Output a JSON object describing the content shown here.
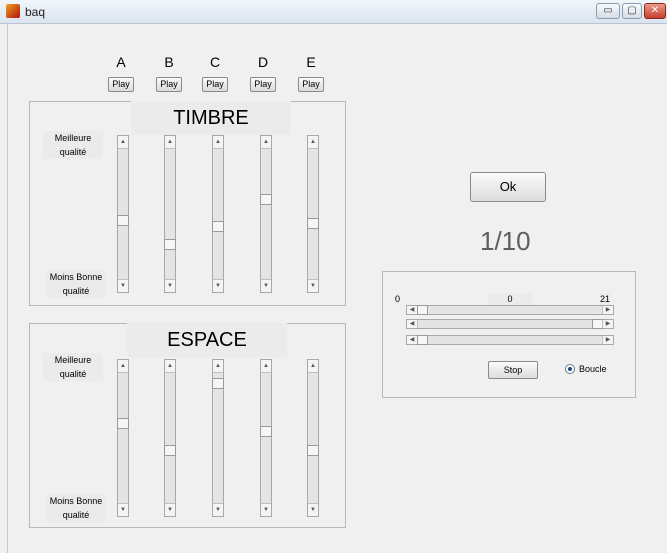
{
  "window": {
    "title": "baq",
    "buttons": {
      "minimize": "▭",
      "maximize": "▢",
      "close": "✕"
    }
  },
  "columns": [
    {
      "letter": "A",
      "play": "Play"
    },
    {
      "letter": "B",
      "play": "Play"
    },
    {
      "letter": "C",
      "play": "Play"
    },
    {
      "letter": "D",
      "play": "Play"
    },
    {
      "letter": "E",
      "play": "Play"
    }
  ],
  "timbre": {
    "title": "TIMBRE",
    "top_label": [
      "Meilleure",
      "qualité"
    ],
    "bottom_label": [
      "Moins Bonne",
      "qualité"
    ],
    "slider_levels": [
      0.45,
      0.25,
      0.4,
      0.62,
      0.42
    ]
  },
  "espace": {
    "title": "ESPACE",
    "top_label": [
      "Meilleure",
      "qualité"
    ],
    "bottom_label": [
      "Moins Bonne",
      "qualité"
    ],
    "slider_levels": [
      0.62,
      0.4,
      0.95,
      0.55,
      0.4
    ]
  },
  "ok_label": "Ok",
  "counter": "1/10",
  "player": {
    "min_label": "0",
    "current_label": "0",
    "max_label": "21",
    "sliders": [
      0,
      1,
      0
    ],
    "stop_label": "Stop",
    "loop_label": "Boucle",
    "loop_checked": true
  },
  "icons": {
    "arrow_up": "▲",
    "arrow_down": "▼",
    "arrow_left": "◀",
    "arrow_right": "▶"
  }
}
